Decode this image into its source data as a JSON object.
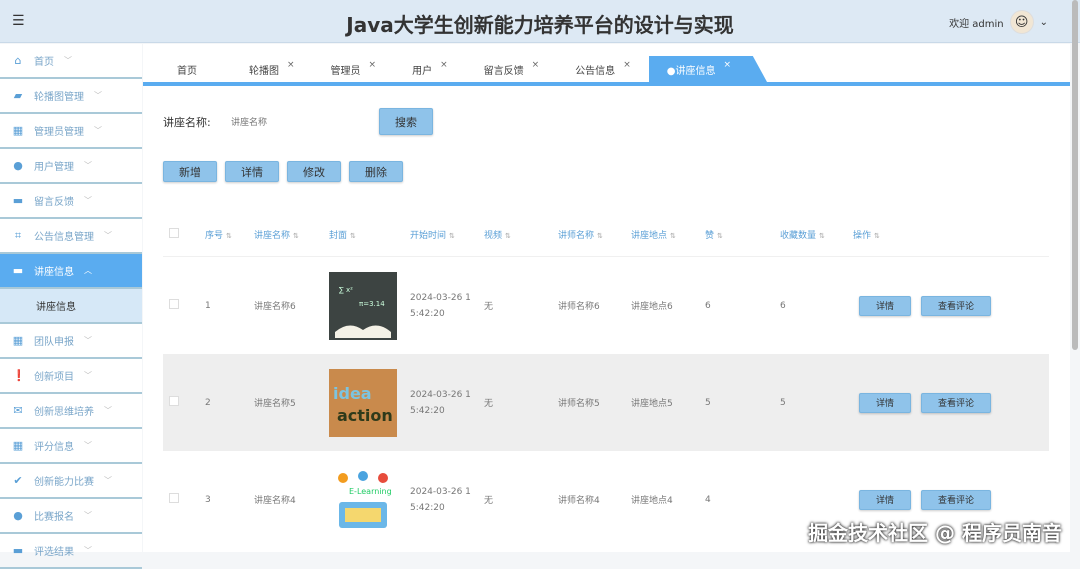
{
  "header": {
    "title": "Java大学生创新能力培养平台的设计与实现",
    "welcome": "欢迎 admin"
  },
  "sidebar": {
    "items": [
      {
        "label": "首页",
        "icon": "home-icon"
      },
      {
        "label": "轮播图管理",
        "icon": "briefcase-icon"
      },
      {
        "label": "管理员管理",
        "icon": "grid-icon"
      },
      {
        "label": "用户管理",
        "icon": "user-icon"
      },
      {
        "label": "留言反馈",
        "icon": "message-icon"
      },
      {
        "label": "公告信息管理",
        "icon": "crop-icon"
      },
      {
        "label": "讲座信息",
        "icon": "screen-icon",
        "active": true
      },
      {
        "label": "团队申报",
        "icon": "grid-icon"
      },
      {
        "label": "创新项目",
        "icon": "alert-icon"
      },
      {
        "label": "创新思维培养",
        "icon": "mail-icon"
      },
      {
        "label": "评分信息",
        "icon": "grid-icon"
      },
      {
        "label": "创新能力比赛",
        "icon": "check-circle-icon"
      },
      {
        "label": "比赛报名",
        "icon": "drop-icon"
      },
      {
        "label": "评选结果",
        "icon": "screen-icon"
      }
    ],
    "sub": "讲座信息"
  },
  "tabs": [
    {
      "label": "首页"
    },
    {
      "label": "轮播图"
    },
    {
      "label": "管理员"
    },
    {
      "label": "用户"
    },
    {
      "label": "留言反馈"
    },
    {
      "label": "公告信息"
    },
    {
      "label": "●讲座信息",
      "active": true
    }
  ],
  "search": {
    "label": "讲座名称:",
    "placeholder": "讲座名称",
    "button": "搜索"
  },
  "actions": {
    "add": "新增",
    "detail": "详情",
    "edit": "修改",
    "delete": "删除"
  },
  "table": {
    "columns": [
      "序号",
      "讲座名称",
      "封面",
      "开始时间",
      "视频",
      "讲师名称",
      "讲座地点",
      "赞",
      "收藏数量",
      "操作"
    ],
    "rows": [
      {
        "no": "1",
        "name": "讲座名称6",
        "time1": "2024-03-26 1",
        "time2": "5:42:20",
        "video": "无",
        "teacher": "讲师名称6",
        "place": "讲座地点6",
        "likes": "6",
        "fav": "6"
      },
      {
        "no": "2",
        "name": "讲座名称5",
        "time1": "2024-03-26 1",
        "time2": "5:42:20",
        "video": "无",
        "teacher": "讲师名称5",
        "place": "讲座地点5",
        "likes": "5",
        "fav": "5"
      },
      {
        "no": "3",
        "name": "讲座名称4",
        "time1": "2024-03-26 1",
        "time2": "5:42:20",
        "video": "无",
        "teacher": "讲师名称4",
        "place": "讲座地点4",
        "likes": "4",
        "fav": ""
      }
    ],
    "detail_btn": "详情",
    "comment_btn": "查看评论"
  },
  "watermark": "掘金技术社区 @ 程序员南音"
}
